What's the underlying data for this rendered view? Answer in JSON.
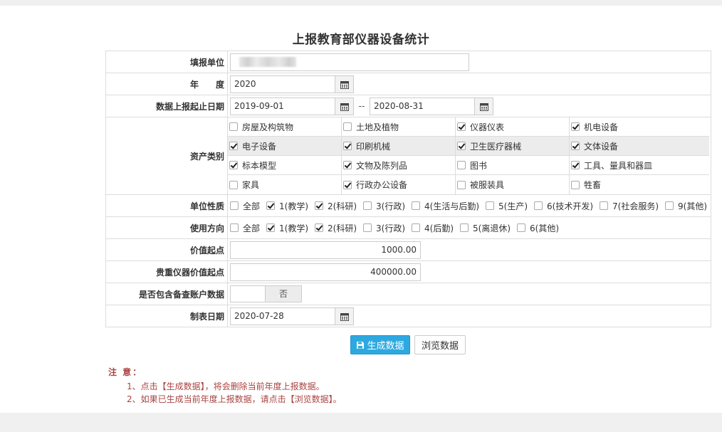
{
  "page": {
    "title": "上报教育部仪器设备统计"
  },
  "form": {
    "unit_label": "填报单位",
    "year_label": "年　　度",
    "year_value": "2020",
    "date_range_label": "数据上报起止日期",
    "date_start": "2019-09-01",
    "date_sep": "--",
    "date_end": "2020-08-31",
    "asset_label": "资产类别",
    "assets": [
      {
        "label": "房屋及构筑物",
        "checked": false
      },
      {
        "label": "土地及植物",
        "checked": false
      },
      {
        "label": "仪器仪表",
        "checked": true
      },
      {
        "label": "机电设备",
        "checked": true
      },
      {
        "label": "电子设备",
        "checked": true
      },
      {
        "label": "印刷机械",
        "checked": true
      },
      {
        "label": "卫生医疗器械",
        "checked": true
      },
      {
        "label": "文体设备",
        "checked": true
      },
      {
        "label": "标本模型",
        "checked": true
      },
      {
        "label": "文物及陈列品",
        "checked": true
      },
      {
        "label": "图书",
        "checked": false
      },
      {
        "label": "工具、量具和器皿",
        "checked": true
      },
      {
        "label": "家具",
        "checked": false
      },
      {
        "label": "行政办公设备",
        "checked": true
      },
      {
        "label": "被服装具",
        "checked": false
      },
      {
        "label": "牲畜",
        "checked": false
      }
    ],
    "unit_nature_label": "单位性质",
    "unit_nature": [
      {
        "label": "全部",
        "checked": false
      },
      {
        "label": "1(教学)",
        "checked": true
      },
      {
        "label": "2(科研)",
        "checked": true
      },
      {
        "label": "3(行政)",
        "checked": false
      },
      {
        "label": "4(生活与后勤)",
        "checked": false
      },
      {
        "label": "5(生产)",
        "checked": false
      },
      {
        "label": "6(技术开发)",
        "checked": false
      },
      {
        "label": "7(社会服务)",
        "checked": false
      },
      {
        "label": "9(其他)",
        "checked": false
      }
    ],
    "usage_label": "使用方向",
    "usage": [
      {
        "label": "全部",
        "checked": false
      },
      {
        "label": "1(教学)",
        "checked": true
      },
      {
        "label": "2(科研)",
        "checked": true
      },
      {
        "label": "3(行政)",
        "checked": false
      },
      {
        "label": "4(后勤)",
        "checked": false
      },
      {
        "label": "5(离退休)",
        "checked": false
      },
      {
        "label": "6(其他)",
        "checked": false
      }
    ],
    "value_start_label": "价值起点",
    "value_start": "1000.00",
    "precious_label": "贵重仪器价值起点",
    "precious_value": "400000.00",
    "backup_label": "是否包含备查账户数据",
    "backup_toggle": "否",
    "table_date_label": "制表日期",
    "table_date": "2020-07-28"
  },
  "buttons": {
    "generate": "生成数据",
    "browse": "浏览数据"
  },
  "notes": {
    "title": "注 意：",
    "line1": "1、点击【生成数据】，将会删除当前年度上报数据。",
    "line2": "2、如果已生成当前年度上报数据，请点击【浏览数据】。"
  },
  "colors": {
    "primary": "#2ea9e0",
    "note": "#a94442"
  }
}
